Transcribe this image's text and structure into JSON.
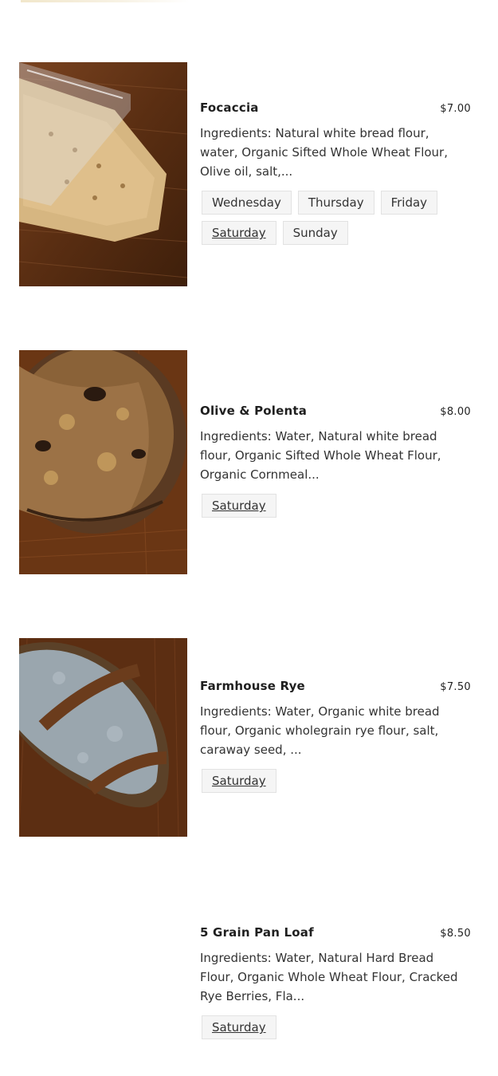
{
  "products": [
    {
      "name": "Focaccia",
      "price": "$7.00",
      "ingredients": "Ingredients: Natural white bread flour, water, Organic Sifted Whole Wheat Flour, Olive oil, salt,...",
      "days": [
        "Wednesday",
        "Thursday",
        "Friday",
        "Saturday",
        "Sunday"
      ],
      "underlined_day": "Saturday",
      "image": "focaccia-in-bag-on-wood"
    },
    {
      "name": "Olive & Polenta",
      "price": "$8.00",
      "ingredients": "Ingredients: Water, Natural white bread flour, Organic Sifted Whole Wheat Flour, Organic Cornmeal...",
      "days": [
        "Saturday"
      ],
      "underlined_day": "Saturday",
      "image": "olive-polenta-loaf-on-wood"
    },
    {
      "name": "Farmhouse Rye",
      "price": "$7.50",
      "ingredients": "Ingredients: Water, Organic white bread flour, Organic wholegrain rye flour, salt, caraway seed, ...",
      "days": [
        "Saturday"
      ],
      "underlined_day": "Saturday",
      "image": "rye-loaf-on-wood"
    },
    {
      "name": "5 Grain Pan Loaf",
      "price": "$8.50",
      "ingredients": "Ingredients: Water, Natural Hard Bread Flour, Organic Whole Wheat Flour, Cracked Rye Berries, Fla...",
      "days": [
        "Saturday"
      ],
      "underlined_day": "Saturday",
      "image": "none"
    }
  ],
  "colors": {
    "tag_background": "#f5f5f5",
    "tag_border": "#e2e2e2",
    "wood": "#6b3a1a"
  }
}
